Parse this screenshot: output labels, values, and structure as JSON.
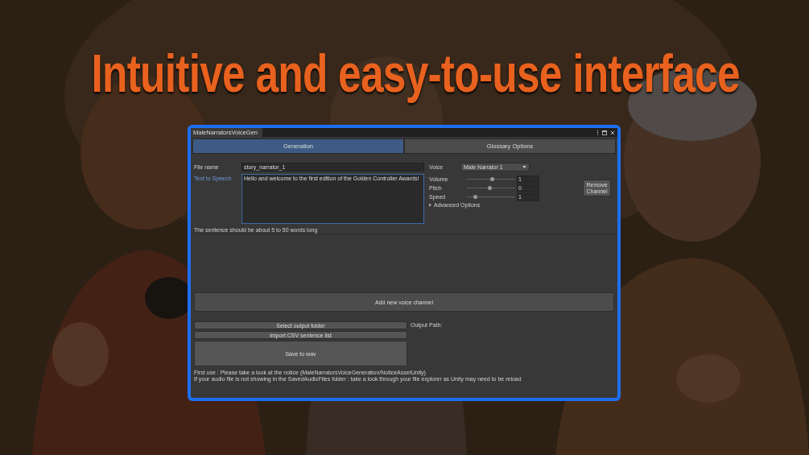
{
  "headline": "Intuitive and easy-to-use interface",
  "window": {
    "title": "MaleNarratorsVoiceGen"
  },
  "tabs": [
    {
      "label": "Generation",
      "selected": true
    },
    {
      "label": "Glossary Options",
      "selected": false
    }
  ],
  "file_name": {
    "label": "File name",
    "value": "story_narrator_1"
  },
  "text_to_speech": {
    "label": "Text to Speech",
    "value": "Hello and welcome to the first edition of the Golden Controller Awards!",
    "focused": true
  },
  "hint": "The sentence should be about 5 to 50 words long",
  "voice": {
    "label": "Voice",
    "value": "Male Narrator 1"
  },
  "sliders": [
    {
      "name": "Volume",
      "level": 0.52,
      "value": "1"
    },
    {
      "name": "Pitch",
      "level": 0.48,
      "value": "0"
    },
    {
      "name": "Speed",
      "level": 0.18,
      "value": "1"
    }
  ],
  "advanced_options": {
    "label": "Advanced Options",
    "expanded": false
  },
  "remove_button": "Remove Channel",
  "add_button": "Add new voice channel",
  "output_buttons": [
    {
      "label": "Select output folder",
      "kind": "small"
    },
    {
      "label": "Import CSV sentence list",
      "kind": "small"
    },
    {
      "label": "Save to wav",
      "kind": "large"
    }
  ],
  "output_path_label": "Output Path:",
  "notices": [
    "First use : Please take a look at the notice (MaleNarratorsVoiceGeneration/NoticeAssetUnity)",
    "If your audio file is not showing in the SavedAudioFiles folder : take a look through your file explorer as Unity may need to be reload"
  ]
}
